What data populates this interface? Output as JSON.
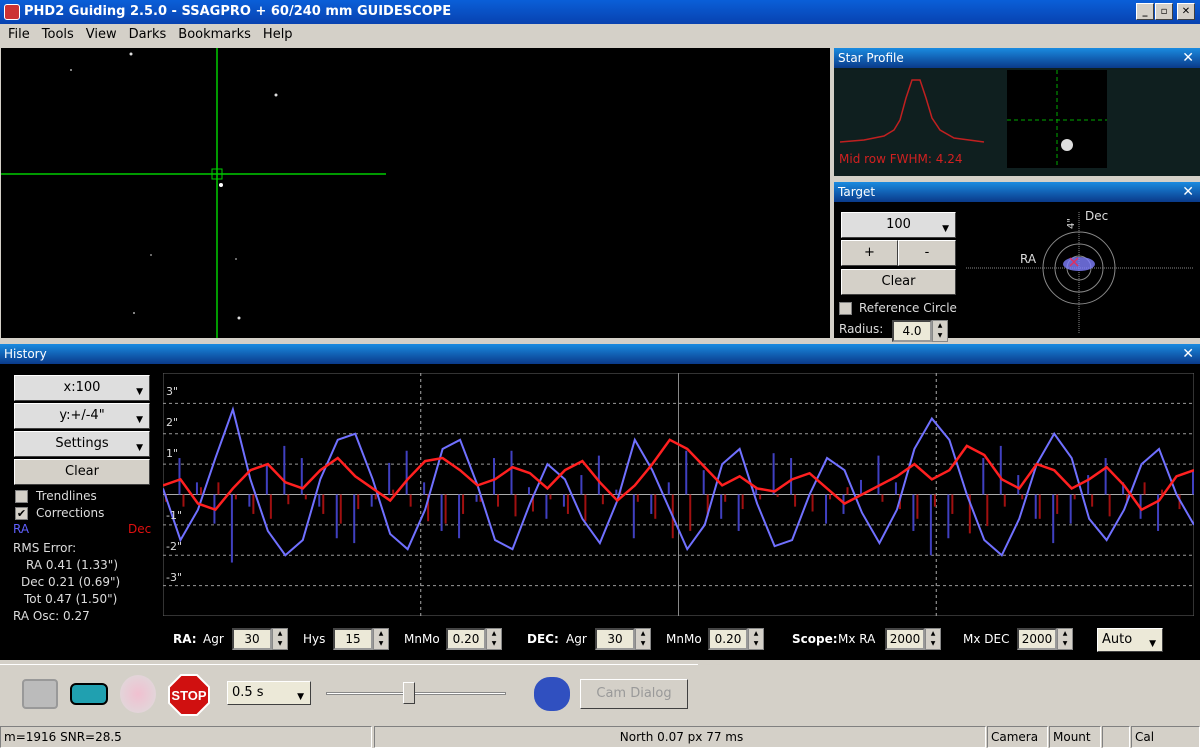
{
  "window": {
    "title": "PHD2 Guiding 2.5.0 - SSAGPRO + 60/240 mm GUIDESCOPE",
    "min": "_",
    "max": "▫",
    "close": "✕"
  },
  "menu": [
    "File",
    "Tools",
    "View",
    "Darks",
    "Bookmarks",
    "Help"
  ],
  "star_profile": {
    "title": "Star Profile",
    "label": "Mid row  FWHM: 4.24"
  },
  "target": {
    "title": "Target",
    "zoom": "100",
    "plus": "+",
    "minus": "-",
    "clear": "Clear",
    "ref_circle": "Reference Circle",
    "radius_label": "Radius:",
    "radius": "4.0",
    "axis_ra": "RA",
    "axis_dec": "Dec",
    "scale": "4\""
  },
  "history": {
    "title": "History",
    "x_scale": "x:100",
    "y_scale": "y:+/-4\"",
    "settings": "Settings",
    "clear": "Clear",
    "trendlines": "Trendlines",
    "trendlines_checked": false,
    "corrections": "Corrections",
    "corrections_checked": true,
    "ra_legend": "RA",
    "dec_legend": "Dec",
    "rms_title": "RMS Error:",
    "rms_ra": "RA  0.41 (1.33\")",
    "rms_dec": "Dec  0.21 (0.69\")",
    "rms_tot": "Tot  0.47 (1.50\")",
    "ra_osc": "RA Osc: 0.27",
    "y_ticks": [
      "3\"",
      "2\"",
      "1\"",
      "-1\"",
      "-2\"",
      "-3\""
    ]
  },
  "chart_data": {
    "type": "line",
    "ylim": [
      -4,
      4
    ],
    "y_ticks": [
      3,
      2,
      1,
      -1,
      -2,
      -3
    ],
    "colors": {
      "ra": "#7070ff",
      "dec": "#ff2020"
    },
    "series": [
      {
        "name": "RA",
        "values": [
          0.2,
          -1.5,
          -0.5,
          1.2,
          2.8,
          0.5,
          -1.2,
          -2,
          -1.5,
          0.5,
          1.8,
          2,
          0.5,
          -1.3,
          -1.8,
          -0.5,
          1.5,
          1.8,
          0.3,
          -1.5,
          -1.8,
          -0.3,
          1,
          0.5,
          -0.8,
          -1.6,
          -0.2,
          1.8,
          0.8,
          -0.5,
          -1.8,
          -1,
          1,
          1.5,
          -0.3,
          -1.7,
          -1.5,
          0,
          1.2,
          0.8,
          -0.6,
          -1.6,
          -0.5,
          1.5,
          2.5,
          1.8,
          0,
          -1.5,
          -2,
          -0.8,
          1,
          2,
          1.2,
          -0.8,
          -1.5,
          -0.5,
          1,
          1.5,
          0,
          -1
        ]
      },
      {
        "name": "Dec",
        "values": [
          0.3,
          0.5,
          -0.3,
          -0.5,
          0.2,
          0.8,
          1,
          0.4,
          0.2,
          0.8,
          1.2,
          0.6,
          0.2,
          -0.2,
          0.5,
          1.1,
          1.2,
          0.8,
          0.3,
          0.5,
          0.9,
          0.7,
          0.2,
          0.8,
          1.1,
          0.4,
          -0.2,
          0.3,
          1,
          1.8,
          1.5,
          0.9,
          0.3,
          0.6,
          0.2,
          0.1,
          0.5,
          0.7,
          0.2,
          -0.3,
          0,
          0.3,
          0.6,
          1,
          0.5,
          0.8,
          1.6,
          1.3,
          0.5,
          0.2,
          1,
          0.8,
          0.2,
          0.5,
          0.9,
          0.3,
          -0.5,
          -0.2,
          0.6,
          0.8
        ]
      }
    ]
  },
  "params": {
    "ra_label": "RA:",
    "agr": "Agr",
    "ra_agr": "30",
    "hys": "Hys",
    "ra_hys": "15",
    "mnmo": "MnMo",
    "ra_mnmo": "0.20",
    "dec_label": "DEC:",
    "dec_agr": "30",
    "dec_mnmo": "0.20",
    "scope_label": "Scope:",
    "mx_ra": "Mx RA",
    "mx_ra_val": "2000",
    "mx_dec": "Mx DEC",
    "mx_dec_val": "2000",
    "mode": "Auto"
  },
  "toolbar": {
    "exposure": "0.5 s",
    "cam_dialog": "Cam Dialog",
    "stop": "STOP"
  },
  "status": {
    "star": "m=1916 SNR=28.5",
    "guide": "North 0.07 px 77 ms",
    "camera": "Camera",
    "mount": "Mount",
    "cal": "Cal"
  }
}
